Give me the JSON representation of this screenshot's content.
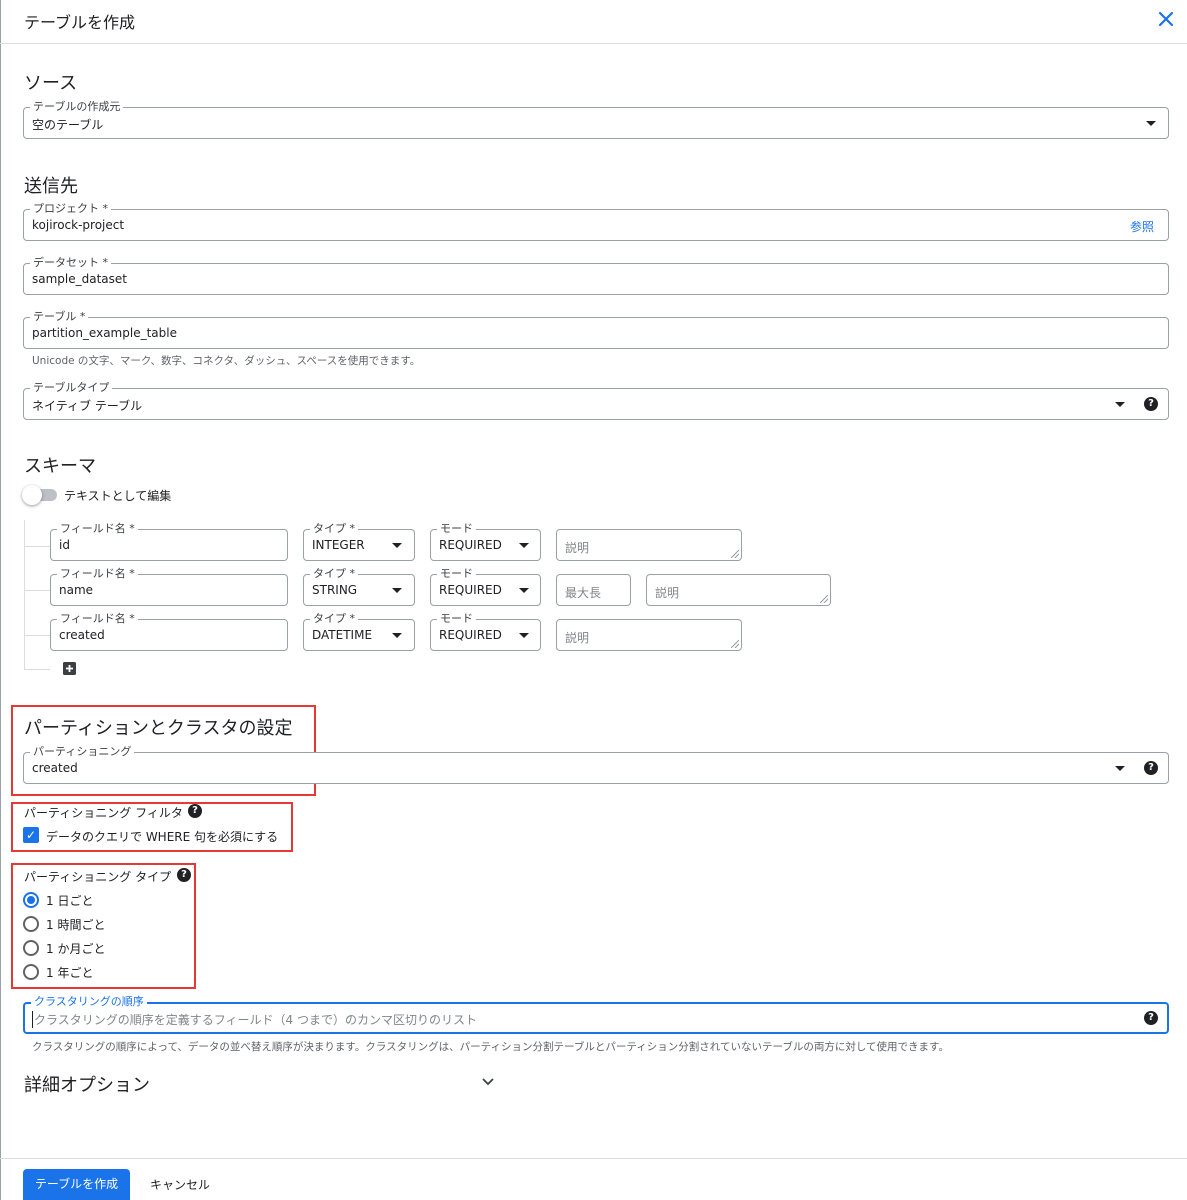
{
  "dialog": {
    "title": "テーブルを作成"
  },
  "source": {
    "heading": "ソース",
    "create_from_label": "テーブルの作成元",
    "create_from_value": "空のテーブル"
  },
  "destination": {
    "heading": "送信先",
    "project_label": "プロジェクト *",
    "project_value": "kojirock-project",
    "browse_label": "参照",
    "dataset_label": "データセット *",
    "dataset_value": "sample_dataset",
    "table_label": "テーブル *",
    "table_value": "partition_example_table",
    "table_hint": "Unicode の文字、マーク、数字、コネクタ、ダッシュ、スペースを使用できます。",
    "table_type_label": "テーブルタイプ",
    "table_type_value": "ネイティブ テーブル"
  },
  "schema": {
    "heading": "スキーマ",
    "edit_as_text_label": "テキストとして編集",
    "edit_as_text_on": false,
    "rows": [
      {
        "field_label": "フィールド名 *",
        "field_value": "id",
        "type_label": "タイプ *",
        "type_value": "INTEGER",
        "mode_label": "モード",
        "mode_value": "REQUIRED",
        "desc_placeholder": "説明"
      },
      {
        "field_label": "フィールド名 *",
        "field_value": "name",
        "type_label": "タイプ *",
        "type_value": "STRING",
        "mode_label": "モード",
        "mode_value": "REQUIRED",
        "maxlen_placeholder": "最大長",
        "desc_placeholder": "説明"
      },
      {
        "field_label": "フィールド名 *",
        "field_value": "created",
        "type_label": "タイプ *",
        "type_value": "DATETIME",
        "mode_label": "モード",
        "mode_value": "REQUIRED",
        "desc_placeholder": "説明"
      }
    ],
    "add_icon": "plus-box-icon"
  },
  "partition": {
    "heading": "パーティションとクラスタの設定",
    "partitioning_label": "パーティショニング",
    "partitioning_value": "created",
    "filter_label": "パーティショニング フィルタ",
    "filter_checkbox_label": "データのクエリで WHERE 句を必須にする",
    "filter_checked": true,
    "type_label": "パーティショニング タイプ",
    "type_options": [
      "1 日ごと",
      "1 時間ごと",
      "1 か月ごと",
      "1 年ごと"
    ],
    "type_selected": 0,
    "clustering_label": "クラスタリングの順序",
    "clustering_placeholder": "クラスタリングの順序を定義するフィールド（4 つまで）のカンマ区切りのリスト",
    "clustering_hint": "クラスタリングの順序によって、データの並べ替え順序が決まります。クラスタリングは、パーティション分割テーブルとパーティション分割されていないテーブルの両方に対して使用できます。"
  },
  "advanced": {
    "heading": "詳細オプション"
  },
  "footer": {
    "create_label": "テーブルを作成",
    "cancel_label": "キャンセル"
  },
  "colors": {
    "accent": "#1a73e8",
    "highlight_box": "#e53935",
    "border": "#9aa0a6"
  }
}
